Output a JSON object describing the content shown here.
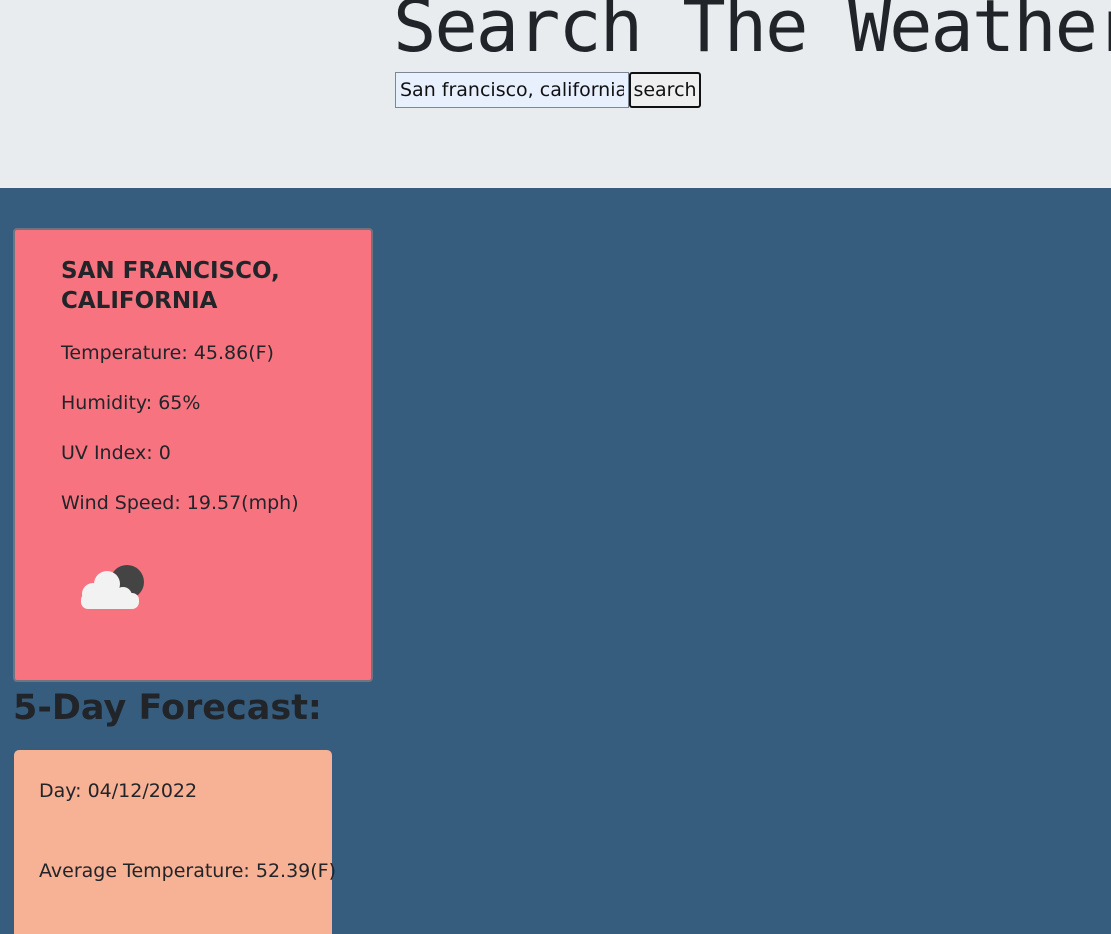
{
  "header": {
    "title": "Search The Weather",
    "search_value": "San francisco, california",
    "search_button": "search"
  },
  "current": {
    "city": "SAN FRANCISCO, CALIFORNIA",
    "temperature": "Temperature: 45.86(F)",
    "humidity": "Humidity: 65%",
    "uv_index": "UV Index: 0",
    "wind_speed": "Wind Speed: 19.57(mph)",
    "icon": "night-cloudy-icon"
  },
  "forecast": {
    "heading": "5-Day Forecast:",
    "days": [
      {
        "day": "Day: 04/12/2022",
        "avg_temp": "Average Temperature: 52.39(F)"
      }
    ]
  },
  "colors": {
    "background": "#365c7e",
    "header_bg": "#e9ecef",
    "current_card": "#f6737f",
    "forecast_card": "#f7b194"
  }
}
